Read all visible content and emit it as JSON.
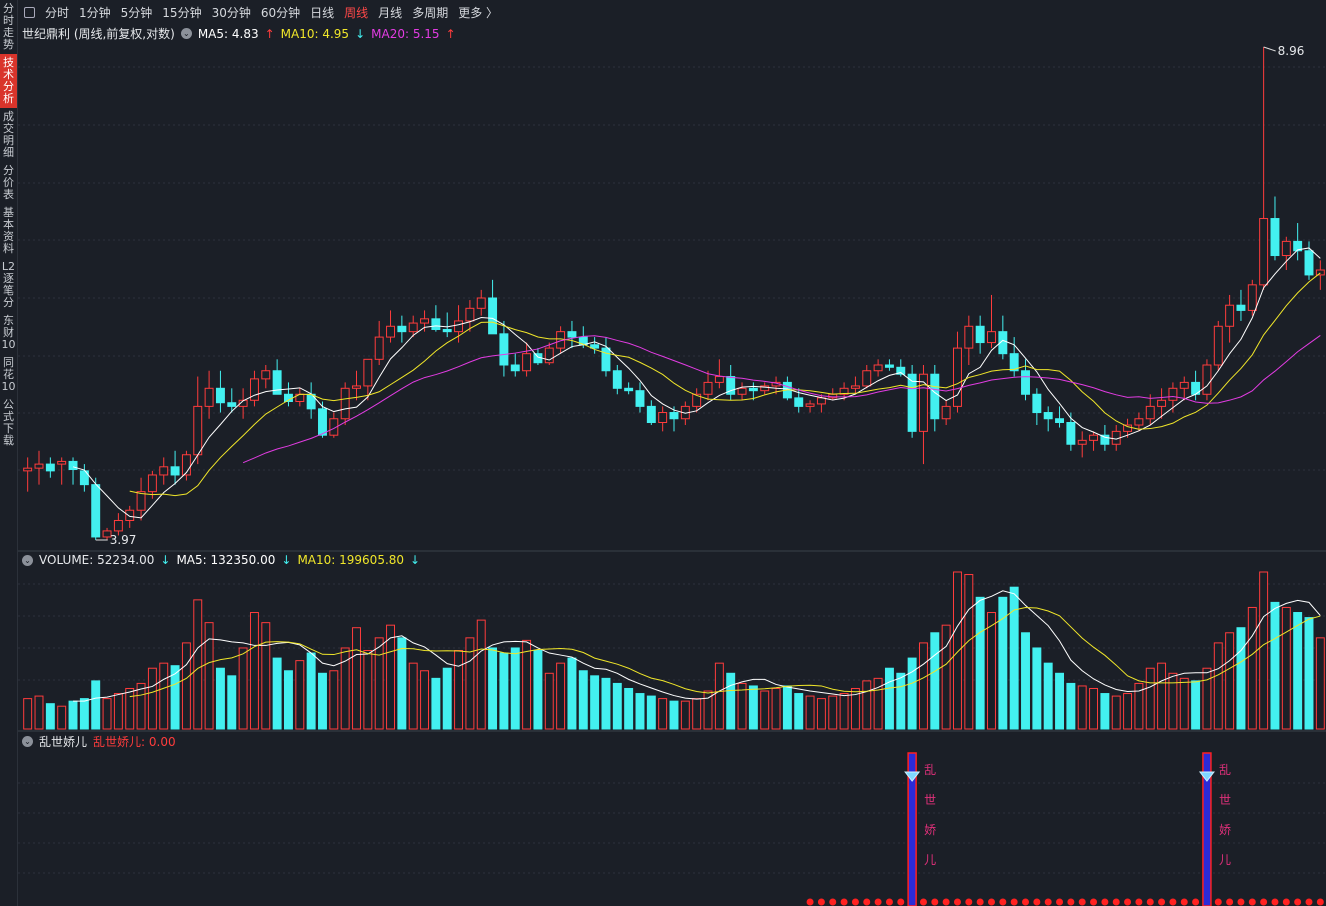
{
  "sidebar": {
    "items": [
      "分时走势",
      "技术分析",
      "成交明细",
      "分价表",
      "基本资料",
      "L2逐笔分",
      "东财10",
      "同花10",
      "公式下载"
    ],
    "active_index": 1
  },
  "toolbar": {
    "items": [
      "分时",
      "1分钟",
      "5分钟",
      "15分钟",
      "30分钟",
      "60分钟",
      "日线",
      "周线",
      "月线",
      "多周期",
      "更多 〉"
    ],
    "active_index": 7
  },
  "main_legend": {
    "title": "世纪鼎利 (周线,前复权,对数)",
    "ma5": "MA5: 4.83",
    "ma5_arrow": "↑",
    "ma10": "MA10: 4.95",
    "ma10_arrow": "↓",
    "ma20": "MA20: 5.15",
    "ma20_arrow": "↑"
  },
  "vol_legend": {
    "volume": "VOLUME: 52234.00",
    "volume_arrow": "↓",
    "ma5": "MA5: 132350.00",
    "ma5_arrow": "↓",
    "ma10": "MA10: 199605.80",
    "ma10_arrow": "↓"
  },
  "ind_legend": {
    "name": "乱世娇儿",
    "value_label": "乱世娇儿: 0.00"
  },
  "colors": {
    "up": "#ff3c3c",
    "down": "#43f0f0",
    "ma5": "#ffffff",
    "ma10": "#f0e62a",
    "ma20": "#e23ce2",
    "signal_text": "#e0307a"
  },
  "chart_data": {
    "type": "candlestick",
    "log_scale": true,
    "price_range": [
      3.97,
      8.96
    ],
    "max_label": "8.96",
    "min_label": "3.97",
    "candles": [
      [
        4.45,
        4.55,
        4.3,
        4.47,
        60
      ],
      [
        4.47,
        4.6,
        4.35,
        4.5,
        65
      ],
      [
        4.5,
        4.55,
        4.4,
        4.45,
        50
      ],
      [
        4.5,
        4.55,
        4.35,
        4.52,
        45
      ],
      [
        4.52,
        4.55,
        4.35,
        4.46,
        55
      ],
      [
        4.45,
        4.5,
        4.3,
        4.35,
        60
      ],
      [
        4.35,
        4.4,
        3.97,
        3.99,
        95
      ],
      [
        3.99,
        4.05,
        3.97,
        4.03,
        60
      ],
      [
        4.03,
        4.15,
        4.0,
        4.1,
        70
      ],
      [
        4.1,
        4.2,
        4.05,
        4.17,
        80
      ],
      [
        4.17,
        4.4,
        4.1,
        4.3,
        90
      ],
      [
        4.3,
        4.45,
        4.25,
        4.42,
        120
      ],
      [
        4.42,
        4.55,
        4.35,
        4.48,
        130
      ],
      [
        4.48,
        4.6,
        4.35,
        4.42,
        125
      ],
      [
        4.42,
        4.6,
        4.38,
        4.57,
        170
      ],
      [
        4.57,
        5.2,
        4.5,
        4.95,
        255
      ],
      [
        4.95,
        5.25,
        4.85,
        5.1,
        210
      ],
      [
        5.1,
        5.25,
        4.9,
        4.98,
        120
      ],
      [
        4.98,
        5.1,
        4.9,
        4.95,
        105
      ],
      [
        4.95,
        5.1,
        4.85,
        5.0,
        160
      ],
      [
        5.0,
        5.25,
        4.95,
        5.18,
        230
      ],
      [
        5.18,
        5.3,
        5.1,
        5.25,
        210
      ],
      [
        5.25,
        5.35,
        5.05,
        5.05,
        140
      ],
      [
        5.05,
        5.15,
        4.95,
        4.99,
        115
      ],
      [
        4.99,
        5.1,
        4.95,
        5.05,
        135
      ],
      [
        5.05,
        5.15,
        4.85,
        4.93,
        150
      ],
      [
        4.93,
        4.99,
        4.7,
        4.72,
        110
      ],
      [
        4.72,
        4.9,
        4.7,
        4.85,
        115
      ],
      [
        4.85,
        5.15,
        4.8,
        5.1,
        160
      ],
      [
        5.1,
        5.25,
        5.0,
        5.12,
        200
      ],
      [
        5.12,
        5.3,
        5.0,
        5.35,
        155
      ],
      [
        5.35,
        5.7,
        5.3,
        5.55,
        180
      ],
      [
        5.55,
        5.8,
        5.5,
        5.65,
        205
      ],
      [
        5.65,
        5.75,
        5.5,
        5.6,
        180
      ],
      [
        5.6,
        5.75,
        5.55,
        5.68,
        130
      ],
      [
        5.68,
        5.8,
        5.6,
        5.72,
        115
      ],
      [
        5.72,
        5.85,
        5.6,
        5.62,
        100
      ],
      [
        5.62,
        5.78,
        5.55,
        5.6,
        120
      ],
      [
        5.6,
        5.85,
        5.5,
        5.7,
        155
      ],
      [
        5.7,
        5.9,
        5.6,
        5.82,
        180
      ],
      [
        5.82,
        6.0,
        5.75,
        5.92,
        215
      ],
      [
        5.92,
        6.1,
        5.85,
        5.58,
        160
      ],
      [
        5.58,
        5.7,
        5.2,
        5.3,
        150
      ],
      [
        5.3,
        5.4,
        5.2,
        5.25,
        160
      ],
      [
        5.25,
        5.5,
        5.2,
        5.4,
        175
      ],
      [
        5.4,
        5.45,
        5.3,
        5.32,
        155
      ],
      [
        5.32,
        5.5,
        5.3,
        5.45,
        110
      ],
      [
        5.45,
        5.65,
        5.4,
        5.6,
        130
      ],
      [
        5.6,
        5.7,
        5.45,
        5.55,
        140
      ],
      [
        5.55,
        5.65,
        5.45,
        5.48,
        115
      ],
      [
        5.48,
        5.55,
        5.4,
        5.45,
        105
      ],
      [
        5.45,
        5.55,
        5.2,
        5.25,
        100
      ],
      [
        5.25,
        5.3,
        5.05,
        5.1,
        90
      ],
      [
        5.1,
        5.15,
        5.05,
        5.08,
        80
      ],
      [
        5.08,
        5.15,
        4.9,
        4.95,
        70
      ],
      [
        4.95,
        5.0,
        4.8,
        4.82,
        65
      ],
      [
        4.82,
        4.95,
        4.75,
        4.9,
        60
      ],
      [
        4.9,
        4.95,
        4.75,
        4.85,
        55
      ],
      [
        4.85,
        4.99,
        4.8,
        4.95,
        55
      ],
      [
        4.95,
        5.1,
        4.9,
        5.05,
        60
      ],
      [
        5.05,
        5.25,
        5.0,
        5.15,
        75
      ],
      [
        5.15,
        5.35,
        5.1,
        5.2,
        130
      ],
      [
        5.2,
        5.3,
        5.0,
        5.05,
        110
      ],
      [
        5.05,
        5.15,
        5.0,
        5.1,
        90
      ],
      [
        5.1,
        5.15,
        5.0,
        5.08,
        85
      ],
      [
        5.08,
        5.15,
        5.05,
        5.12,
        75
      ],
      [
        5.12,
        5.2,
        5.05,
        5.15,
        80
      ],
      [
        5.15,
        5.2,
        5.0,
        5.02,
        85
      ],
      [
        5.02,
        5.1,
        4.9,
        4.95,
        70
      ],
      [
        4.95,
        5.0,
        4.9,
        4.97,
        65
      ],
      [
        4.97,
        5.05,
        4.9,
        5.02,
        60
      ],
      [
        5.02,
        5.1,
        5.0,
        5.05,
        65
      ],
      [
        5.05,
        5.15,
        5.0,
        5.1,
        70
      ],
      [
        5.1,
        5.2,
        5.05,
        5.12,
        80
      ],
      [
        5.12,
        5.3,
        5.1,
        5.25,
        95
      ],
      [
        5.25,
        5.35,
        5.2,
        5.3,
        100
      ],
      [
        5.3,
        5.35,
        5.25,
        5.28,
        120
      ],
      [
        5.28,
        5.35,
        5.2,
        5.22,
        110
      ],
      [
        5.22,
        5.3,
        4.7,
        4.75,
        140
      ],
      [
        4.75,
        5.3,
        4.5,
        5.22,
        170
      ],
      [
        5.22,
        5.3,
        4.75,
        4.85,
        190
      ],
      [
        4.85,
        5.0,
        4.8,
        4.95,
        205
      ],
      [
        4.95,
        5.6,
        4.9,
        5.45,
        310
      ],
      [
        5.45,
        5.75,
        5.3,
        5.65,
        305
      ],
      [
        5.65,
        5.75,
        5.4,
        5.5,
        260
      ],
      [
        5.5,
        5.95,
        5.45,
        5.6,
        230
      ],
      [
        5.6,
        5.75,
        5.35,
        5.4,
        260
      ],
      [
        5.4,
        5.55,
        5.2,
        5.25,
        280
      ],
      [
        5.25,
        5.35,
        5.0,
        5.05,
        190
      ],
      [
        5.05,
        5.1,
        4.8,
        4.9,
        160
      ],
      [
        4.9,
        4.95,
        4.75,
        4.85,
        130
      ],
      [
        4.85,
        4.95,
        4.78,
        4.82,
        110
      ],
      [
        4.82,
        4.9,
        4.6,
        4.65,
        90
      ],
      [
        4.65,
        4.75,
        4.55,
        4.68,
        85
      ],
      [
        4.68,
        4.75,
        4.6,
        4.72,
        80
      ],
      [
        4.72,
        4.8,
        4.6,
        4.65,
        70
      ],
      [
        4.65,
        4.8,
        4.6,
        4.75,
        65
      ],
      [
        4.75,
        4.85,
        4.7,
        4.8,
        70
      ],
      [
        4.8,
        4.9,
        4.75,
        4.85,
        90
      ],
      [
        4.85,
        5.05,
        4.8,
        4.95,
        120
      ],
      [
        4.95,
        5.1,
        4.85,
        5.0,
        130
      ],
      [
        5.0,
        5.15,
        4.9,
        5.1,
        110
      ],
      [
        5.1,
        5.2,
        5.0,
        5.15,
        100
      ],
      [
        5.15,
        5.25,
        5.0,
        5.05,
        95
      ],
      [
        5.05,
        5.35,
        5.0,
        5.3,
        120
      ],
      [
        5.3,
        5.7,
        5.25,
        5.65,
        170
      ],
      [
        5.65,
        5.95,
        5.5,
        5.85,
        190
      ],
      [
        5.85,
        6.0,
        5.7,
        5.8,
        200
      ],
      [
        5.8,
        6.1,
        5.75,
        6.05,
        240
      ],
      [
        6.05,
        8.96,
        6.0,
        6.75,
        310
      ],
      [
        6.75,
        7.0,
        6.3,
        6.35,
        250
      ],
      [
        6.35,
        6.55,
        6.2,
        6.5,
        240
      ],
      [
        6.5,
        6.7,
        6.3,
        6.4,
        230
      ],
      [
        6.4,
        6.5,
        6.1,
        6.15,
        220
      ],
      [
        6.15,
        6.3,
        6.0,
        6.2,
        180
      ]
    ]
  }
}
